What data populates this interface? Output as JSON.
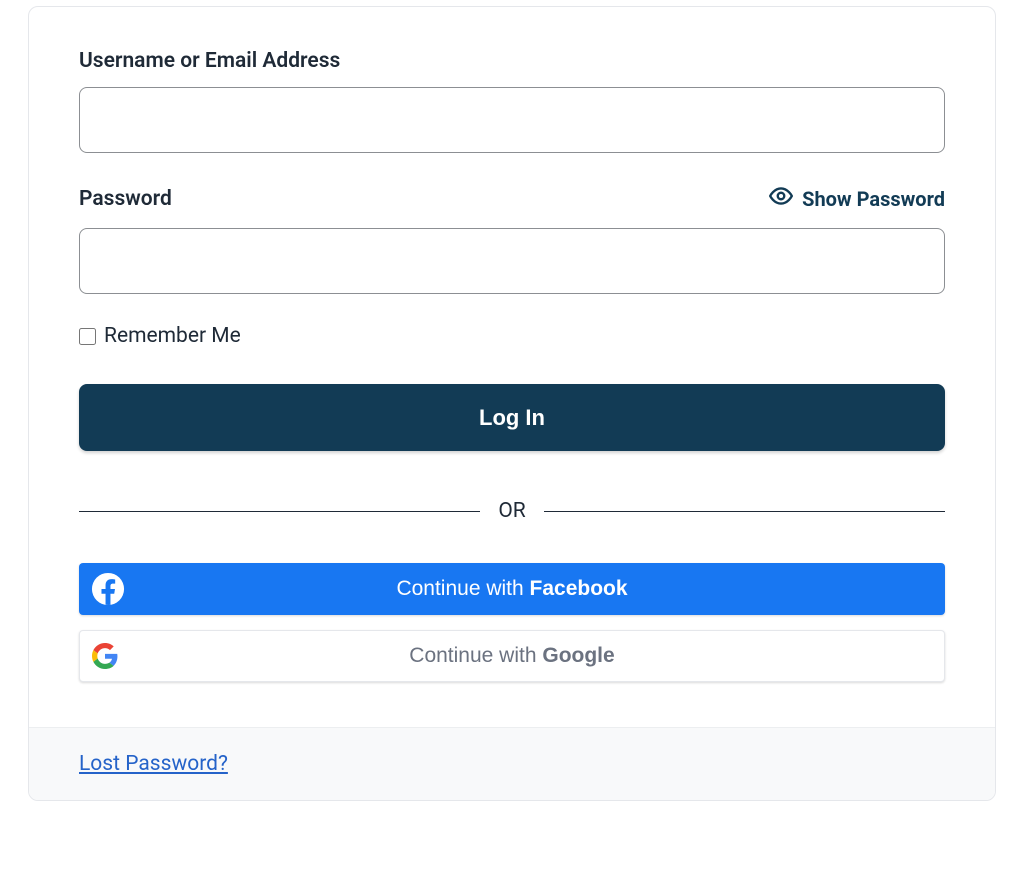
{
  "form": {
    "username_label": "Username or Email Address",
    "password_label": "Password",
    "show_password_label": "Show Password",
    "remember_label": "Remember Me",
    "login_button_label": "Log In"
  },
  "divider": {
    "text": "OR"
  },
  "social": {
    "facebook_prefix": "Continue with ",
    "facebook_provider": "Facebook",
    "google_prefix": "Continue with ",
    "google_provider": "Google"
  },
  "footer": {
    "lost_password_label": "Lost Password?"
  },
  "colors": {
    "primary": "#123b55",
    "facebook": "#1877f2",
    "link": "#2563c9"
  }
}
